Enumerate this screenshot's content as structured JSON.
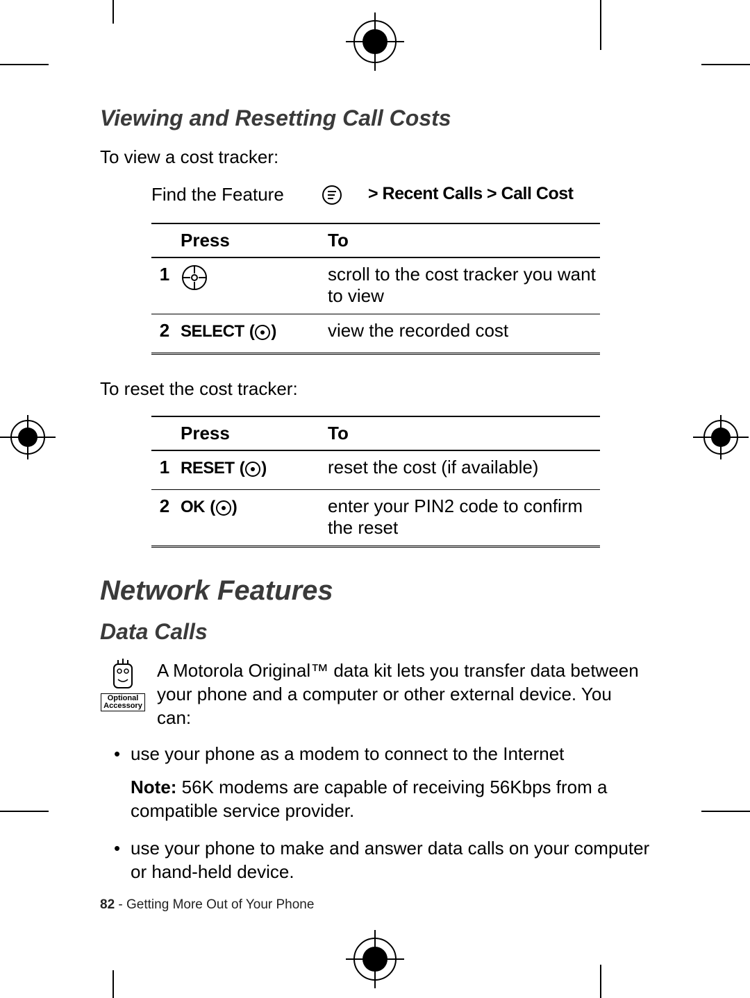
{
  "section1": {
    "heading": "Viewing and Resetting Call Costs",
    "intro1": "To view a cost tracker:",
    "find_feature_label": "Find the Feature",
    "nav_path": "> Recent Calls > Call Cost",
    "intro2": "To reset the cost tracker:"
  },
  "table1": {
    "col_press": "Press",
    "col_to": "To",
    "rows": [
      {
        "n": "1",
        "press_icon": "nav",
        "press_text": "",
        "to": "scroll to the cost tracker you want to view"
      },
      {
        "n": "2",
        "press_icon": "dot",
        "press_text": "SELECT",
        "to": "view the recorded cost"
      }
    ]
  },
  "table2": {
    "col_press": "Press",
    "col_to": "To",
    "rows": [
      {
        "n": "1",
        "press_icon": "dot",
        "press_text": "RESET",
        "to": "reset the cost (if available)"
      },
      {
        "n": "2",
        "press_icon": "dot",
        "press_text": "OK",
        "to": "enter your PIN2 code to confirm the reset"
      }
    ]
  },
  "section2": {
    "h1": "Network Features",
    "h2": "Data Calls",
    "badge_line1": "Optional",
    "badge_line2": "Accessory",
    "para": "A Motorola Original™ data kit lets you transfer data between your phone and a computer or other external device. You can:",
    "bullets": [
      {
        "text": "use your phone as a modem to connect to the Internet",
        "note_label": "Note:",
        "note_text": " 56K modems are capable of receiving 56Kbps from a compatible service provider."
      },
      {
        "text": "use your phone to make and answer data calls on your computer or hand-held device."
      }
    ]
  },
  "footer": {
    "page": "82",
    "sep": " - ",
    "chapter": "Getting More Out of Your Phone"
  }
}
